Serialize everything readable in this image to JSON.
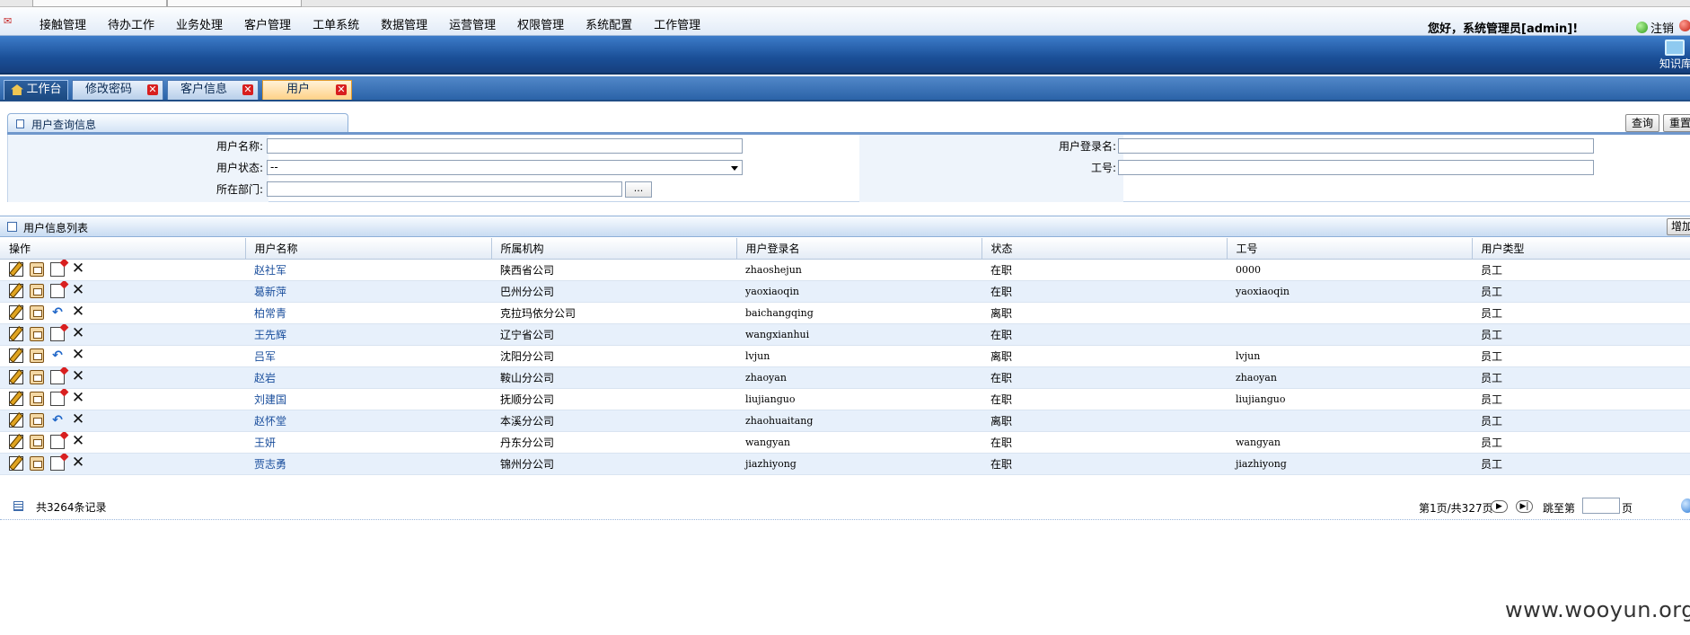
{
  "menu": [
    "接触管理",
    "待办工作",
    "业务处理",
    "客户管理",
    "工单系统",
    "数据管理",
    "运营管理",
    "权限管理",
    "系统配置",
    "工作管理"
  ],
  "header": {
    "greeting": "您好，系统管理员[admin]!",
    "logout": "注销",
    "knowledge": "知识库"
  },
  "tabs": [
    {
      "label": "工作台"
    },
    {
      "label": "修改密码"
    },
    {
      "label": "客户信息"
    },
    {
      "label": "用户"
    }
  ],
  "query": {
    "title": "用户查询信息",
    "search_btn": "查询",
    "reset_btn": "重置",
    "labels": {
      "username": "用户名称:",
      "login": "用户登录名:",
      "status": "用户状态:",
      "jobno": "工号:",
      "dept": "所在部门:"
    },
    "values": {
      "status": "--",
      "dots": "..."
    }
  },
  "list": {
    "title": "用户信息列表",
    "add_btn": "增加",
    "headers": [
      "操作",
      "用户名称",
      "所属机构",
      "用户登录名",
      "状态",
      "工号",
      "用户类型"
    ],
    "rows": [
      {
        "name": "赵社军",
        "org": "陕西省公司",
        "login": "zhaoshejun",
        "status": "在职",
        "jobno": "0000",
        "type": "员工",
        "third": "disable"
      },
      {
        "name": "葛新萍",
        "org": "巴州分公司",
        "login": "yaoxiaoqin",
        "status": "在职",
        "jobno": "yaoxiaoqin",
        "type": "员工",
        "third": "disable"
      },
      {
        "name": "柏常青",
        "org": "克拉玛依分公司",
        "login": "baichangqing",
        "status": "离职",
        "jobno": "",
        "type": "员工",
        "third": "restore"
      },
      {
        "name": "王先辉",
        "org": "辽宁省公司",
        "login": "wangxianhui",
        "status": "在职",
        "jobno": "",
        "type": "员工",
        "third": "disable"
      },
      {
        "name": "吕军",
        "org": "沈阳分公司",
        "login": "lvjun",
        "status": "离职",
        "jobno": "lvjun",
        "type": "员工",
        "third": "restore"
      },
      {
        "name": "赵岩",
        "org": "鞍山分公司",
        "login": "zhaoyan",
        "status": "在职",
        "jobno": "zhaoyan",
        "type": "员工",
        "third": "disable"
      },
      {
        "name": "刘建国",
        "org": "抚顺分公司",
        "login": "liujianguo",
        "status": "在职",
        "jobno": "liujianguo",
        "type": "员工",
        "third": "disable"
      },
      {
        "name": "赵怀堂",
        "org": "本溪分公司",
        "login": "zhaohuaitang",
        "status": "离职",
        "jobno": "",
        "type": "员工",
        "third": "restore"
      },
      {
        "name": "王妍",
        "org": "丹东分公司",
        "login": "wangyan",
        "status": "在职",
        "jobno": "wangyan",
        "type": "员工",
        "third": "disable"
      },
      {
        "name": "贾志勇",
        "org": "锦州分公司",
        "login": "jiazhiyong",
        "status": "在职",
        "jobno": "jiazhiyong",
        "type": "员工",
        "third": "disable"
      }
    ]
  },
  "footer": {
    "total": "共3264条记录",
    "pages": "第1页/共327页",
    "jump": "跳至第",
    "page_unit": "页"
  },
  "watermark": "www.wooyun.org",
  "icons": {
    "edit": "edit-icon",
    "role": "assign-role-icon",
    "disable": "disable-icon",
    "restore": "restore-icon",
    "delete": "delete-icon"
  },
  "colors": {
    "banner": "#1a4f97",
    "active_tab": "#ffd187",
    "link": "#1a4e9c",
    "alt_row": "#e7f0fb"
  }
}
